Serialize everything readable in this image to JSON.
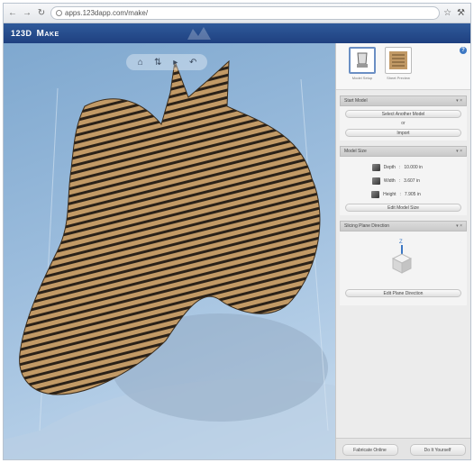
{
  "browser": {
    "back_icon": "back-arrow-icon",
    "forward_icon": "forward-arrow-icon",
    "reload_icon": "reload-icon",
    "url": "apps.123dapp.com/make/",
    "star_icon": "star-icon",
    "wrench_icon": "wrench-icon"
  },
  "app": {
    "brand": "123D",
    "product": "Make"
  },
  "viewport": {
    "tools": [
      "home-icon",
      "step-icon",
      "play-icon",
      "undo-icon"
    ]
  },
  "panel": {
    "tabs": [
      {
        "label": "Model Setup",
        "active": true
      },
      {
        "label": "Sheet Preview",
        "active": false
      }
    ],
    "help": "?",
    "sections": {
      "start_model": {
        "title": "Start Model",
        "select_button": "Select Another Model",
        "or": "or",
        "import_button": "Import"
      },
      "model_size": {
        "title": "Model Size",
        "depth_label": "Depth",
        "depth_value": "10.000",
        "depth_unit": "in",
        "width_label": "Width",
        "width_value": "3.607",
        "width_unit": "in",
        "height_label": "Height",
        "height_value": "7.905",
        "height_unit": "in",
        "edit_button": "Edit Model Size"
      },
      "slicing": {
        "title": "Slicing Plane Direction",
        "axis_label": "Z",
        "edit_button": "Edit Plane Direction"
      }
    },
    "fabricate_button": "Fabricate Online",
    "diy_button": "Do It Yourself"
  },
  "colors": {
    "header_blue": "#1f4080",
    "cardboard": "#b38d5e",
    "viewport_blue": "#9cbddd"
  }
}
